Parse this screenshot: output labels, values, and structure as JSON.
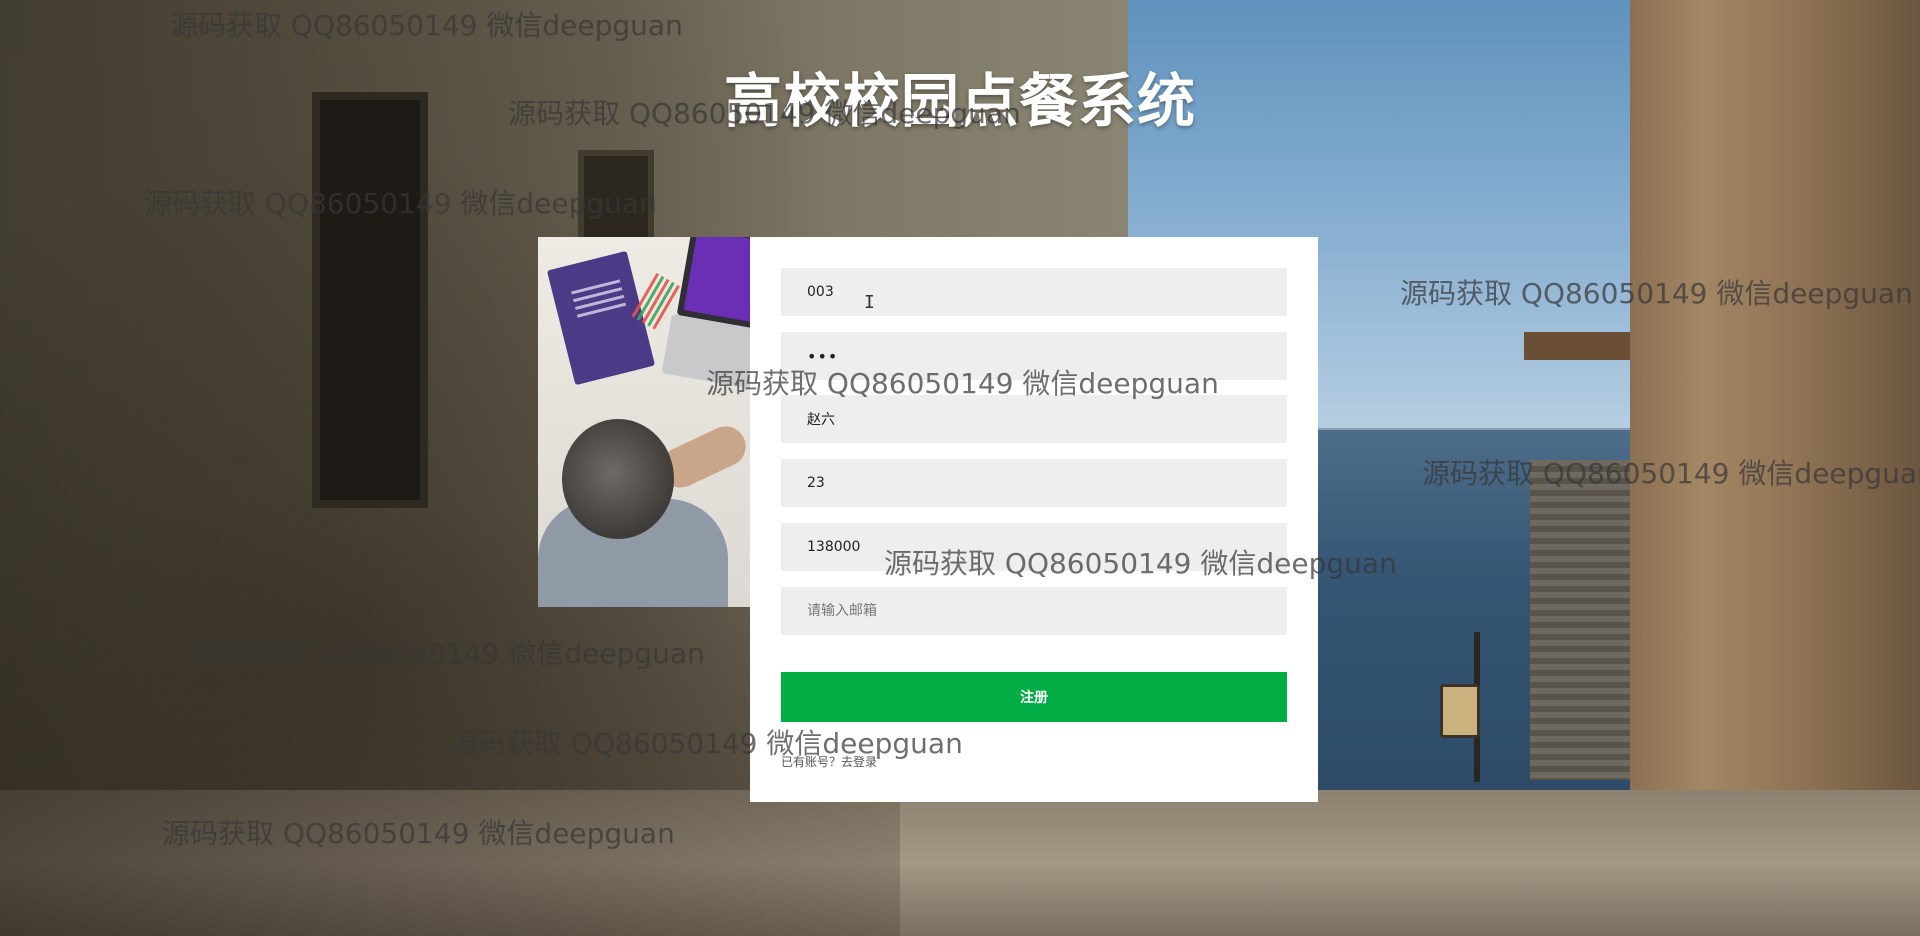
{
  "header": {
    "title": "高校校园点餐系统"
  },
  "register_form": {
    "account": {
      "value": "003",
      "placeholder": ""
    },
    "password": {
      "value": "•••",
      "placeholder": ""
    },
    "name": {
      "value": "赵六",
      "placeholder": ""
    },
    "age": {
      "value": "23",
      "placeholder": ""
    },
    "phone": {
      "value": "138000",
      "placeholder": ""
    },
    "email": {
      "value": "",
      "placeholder": "请输入邮箱"
    },
    "submit_label": "注册",
    "login_link": "已有账号？去登录"
  },
  "watermark": {
    "text": "源码获取 QQ86050149 微信deepguan"
  },
  "colors": {
    "button": "#02ad45",
    "field_bg": "#eeeeee",
    "card_bg": "#ffffff",
    "title": "#ffffff"
  },
  "icons": [
    "text-cursor-icon"
  ]
}
